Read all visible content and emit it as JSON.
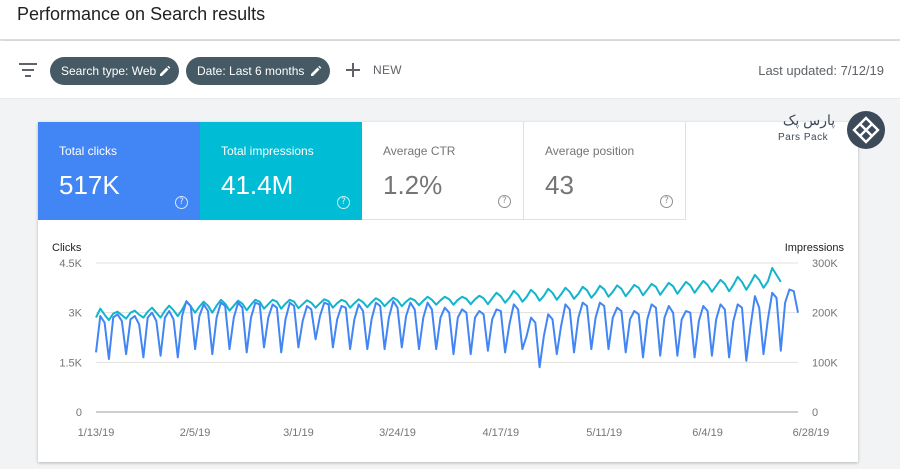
{
  "page": {
    "title": "Performance on Search results"
  },
  "filters": {
    "filter_icon": "filter-icon",
    "chips": [
      {
        "label": "Search type: Web",
        "icon": "pencil-icon"
      },
      {
        "label": "Date: Last 6 months",
        "icon": "pencil-icon"
      }
    ],
    "new_label": "NEW",
    "last_updated": "Last updated: 7/12/19"
  },
  "metrics": [
    {
      "label": "Total clicks",
      "value": "517K",
      "help": "?",
      "color": "#4285f4"
    },
    {
      "label": "Total impressions",
      "value": "41.4M",
      "help": "?",
      "color": "#00bcd4"
    },
    {
      "label": "Average CTR",
      "value": "1.2%",
      "help": "?"
    },
    {
      "label": "Average position",
      "value": "43",
      "help": "?"
    }
  ],
  "watermark": {
    "text_fa": "پارس پک",
    "text_en": "Pars Pack"
  },
  "chart_data": {
    "type": "line",
    "ylabel_left": "Clicks",
    "ylabel_right": "Impressions",
    "y_left_ticks": [
      "4.5K",
      "3K",
      "1.5K",
      "0"
    ],
    "y_right_ticks": [
      "300K",
      "200K",
      "100K",
      "0"
    ],
    "ylim_left": [
      0,
      4500
    ],
    "ylim_right": [
      0,
      300000
    ],
    "x_ticks": [
      "1/13/19",
      "2/5/19",
      "3/1/19",
      "3/24/19",
      "4/17/19",
      "5/11/19",
      "6/4/19",
      "6/28/19"
    ],
    "x_tick_days": [
      0,
      23,
      47,
      70,
      94,
      118,
      142,
      166
    ],
    "grid": true,
    "series": [
      {
        "name": "Clicks",
        "axis": "left",
        "color": "#4285f4",
        "values": [
          1800,
          2900,
          2700,
          1600,
          2850,
          2950,
          2750,
          1750,
          2800,
          2900,
          2650,
          1650,
          2850,
          3000,
          2750,
          1700,
          2850,
          3050,
          2800,
          1650,
          2900,
          3350,
          3200,
          1900,
          2900,
          3250,
          3050,
          1750,
          2850,
          3300,
          3200,
          1900,
          2850,
          3300,
          3150,
          1800,
          2850,
          3300,
          3250,
          1950,
          2850,
          3250,
          3150,
          1800,
          2800,
          3300,
          3200,
          1950,
          2750,
          3200,
          3100,
          2200,
          2900,
          3300,
          3250,
          1950,
          2800,
          3200,
          3150,
          1900,
          2800,
          3250,
          3050,
          1900,
          2800,
          3300,
          3200,
          1900,
          2850,
          3350,
          3150,
          1950,
          2900,
          3300,
          3100,
          1900,
          2850,
          3300,
          3100,
          1900,
          2850,
          3150,
          3000,
          1750,
          2850,
          3100,
          3000,
          1750,
          2850,
          3050,
          2950,
          1850,
          2800,
          3100,
          3050,
          1800,
          2650,
          3250,
          3100,
          1900,
          2300,
          2850,
          2700,
          1350,
          2300,
          2950,
          2800,
          1750,
          2600,
          3250,
          3100,
          1800,
          2850,
          3300,
          3200,
          1900,
          2850,
          3300,
          3200,
          1900,
          2850,
          3150,
          3050,
          1800,
          2800,
          3050,
          2950,
          1650,
          2800,
          3250,
          3150,
          1700,
          2850,
          3200,
          3000,
          1700,
          2800,
          3050,
          3000,
          1650,
          2750,
          3200,
          3050,
          1700,
          2800,
          3250,
          3100,
          1650,
          2750,
          3250,
          3150,
          1550,
          2600,
          3500,
          3150,
          1750,
          2800,
          3600,
          3450,
          1850,
          3300,
          3700,
          3650,
          3000
        ]
      },
      {
        "name": "Impressions",
        "axis": "right",
        "color": "#12b5cb",
        "values": [
          190000,
          208000,
          196000,
          185000,
          198000,
          202000,
          195000,
          188000,
          200000,
          204000,
          196000,
          190000,
          202000,
          210000,
          200000,
          190000,
          204000,
          214000,
          205000,
          193000,
          206000,
          222000,
          213000,
          200000,
          212000,
          222000,
          214000,
          200000,
          214000,
          226000,
          218000,
          204000,
          214000,
          224000,
          218000,
          205000,
          216000,
          226000,
          222000,
          208000,
          217000,
          226000,
          222000,
          208000,
          218000,
          226000,
          222000,
          209000,
          217000,
          225000,
          220000,
          210000,
          219000,
          227000,
          223000,
          210000,
          219000,
          226000,
          222000,
          210000,
          219000,
          227000,
          221000,
          211000,
          221000,
          229000,
          224000,
          213000,
          222000,
          230000,
          225000,
          213000,
          222000,
          229000,
          225000,
          215000,
          224000,
          232000,
          226000,
          216000,
          225000,
          232000,
          227000,
          216000,
          226000,
          232000,
          228000,
          217000,
          227000,
          234000,
          229000,
          217000,
          229000,
          240000,
          233000,
          220000,
          230000,
          244000,
          236000,
          222000,
          232000,
          246000,
          238000,
          224000,
          234000,
          248000,
          240000,
          226000,
          237000,
          250000,
          242000,
          228000,
          238000,
          252000,
          245000,
          230000,
          240000,
          254000,
          247000,
          232000,
          242000,
          255000,
          248000,
          233000,
          244000,
          256000,
          250000,
          235000,
          246000,
          258000,
          252000,
          236000,
          248000,
          260000,
          253000,
          238000,
          250000,
          262000,
          255000,
          240000,
          252000,
          264000,
          256000,
          242000,
          254000,
          266000,
          258000,
          243000,
          256000,
          272000,
          262000,
          246000,
          260000,
          276000,
          266000,
          250000,
          263000,
          290000,
          276000,
          262000
        ]
      }
    ]
  }
}
